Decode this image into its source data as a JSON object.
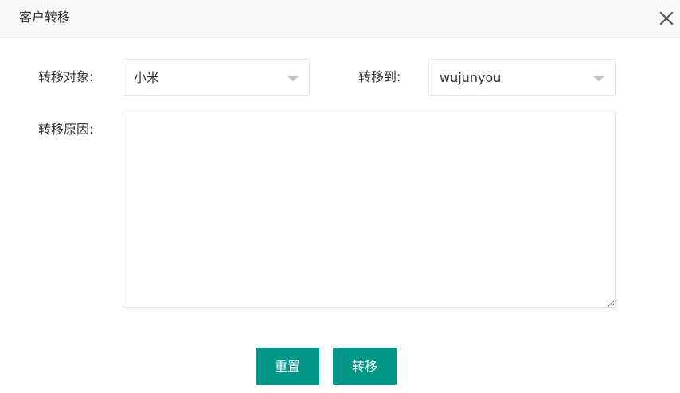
{
  "dialog": {
    "title": "客户转移",
    "close_icon": "close-icon"
  },
  "form": {
    "target_label": "转移对象:",
    "target_value": "小米",
    "transfer_to_label": "转移到:",
    "transfer_to_value": "wujunyou",
    "reason_label": "转移原因:",
    "reason_value": ""
  },
  "buttons": {
    "reset_label": "重置",
    "transfer_label": "转移"
  },
  "colors": {
    "primary": "#009688",
    "header_bg": "#f8f8f8",
    "border": "#e6e6e6",
    "caret": "#c2c2c2"
  }
}
